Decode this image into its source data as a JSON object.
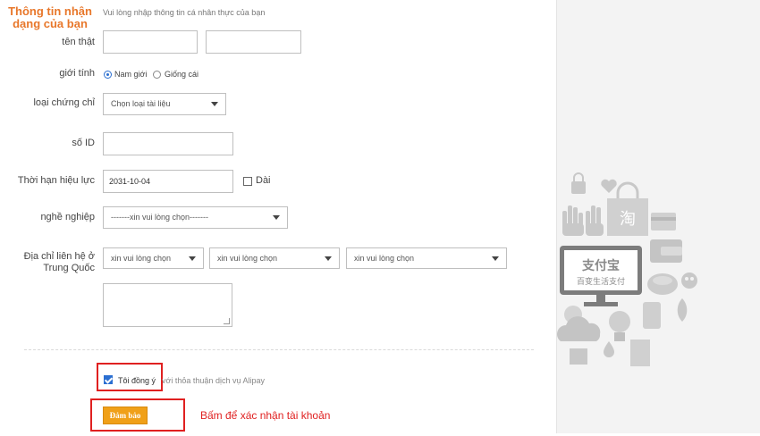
{
  "header": {
    "title": "Thông tin nhận dạng của bạn",
    "description": "Vui lòng nhập thông tin cá nhân thực của bạn"
  },
  "form": {
    "name_label": "tên thật",
    "gender_label": "giới tính",
    "gender_options": [
      "Nam giới",
      "Giống cái"
    ],
    "gender_selected": "Nam giới",
    "cert_label": "loại chứng chỉ",
    "cert_value": "Chọn loại tài liệu",
    "id_label": "số ID",
    "validity_label": "Thời hạn hiệu lực",
    "validity_value": "2031-10-04",
    "long_term_label": "Dài",
    "occupation_label": "nghề nghiệp",
    "occupation_value": "-------xin vui lòng chọn-------",
    "address_label_line1": "Địa chỉ liên hệ ở",
    "address_label_line2": "Trung Quốc",
    "address_selects": [
      "xin vui lòng chọn",
      "xin vui lòng chọn",
      "xin vui lòng chọn"
    ],
    "agree_label": "Tôi đồng ý",
    "agree_rest": "với thỏa thuận dịch vụ Alipay",
    "submit_label": "Đảm bảo",
    "confirm_note": "Bấm để xác nhận tài khoản"
  },
  "illustration": {
    "brand_cn": "支付宝",
    "tagline_cn": "百变生活支付",
    "bag_char": "淘",
    "icon_color": "#c8c8c8"
  },
  "colors": {
    "accent": "#e8772a",
    "button": "#f0a018",
    "highlight": "#e02020",
    "checkbox": "#2b6fd1"
  }
}
